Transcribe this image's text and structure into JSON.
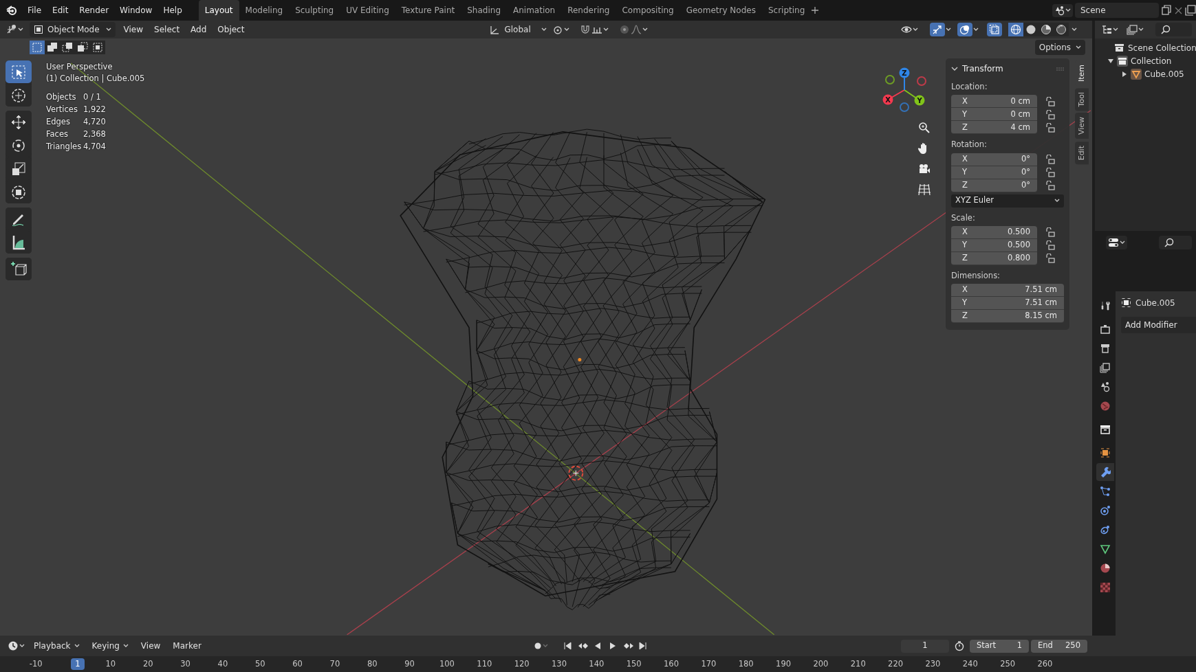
{
  "menu_bar": {
    "menus": [
      "File",
      "Edit",
      "Render",
      "Window",
      "Help"
    ],
    "workspaces": [
      {
        "label": "Layout",
        "selected": true
      },
      {
        "label": "Modeling",
        "selected": false
      },
      {
        "label": "Sculpting",
        "selected": false
      },
      {
        "label": "UV Editing",
        "selected": false
      },
      {
        "label": "Texture Paint",
        "selected": false
      },
      {
        "label": "Shading",
        "selected": false
      },
      {
        "label": "Animation",
        "selected": false
      },
      {
        "label": "Rendering",
        "selected": false
      },
      {
        "label": "Compositing",
        "selected": false
      },
      {
        "label": "Geometry Nodes",
        "selected": false
      },
      {
        "label": "Scripting",
        "selected": false
      }
    ],
    "scene": "Scene"
  },
  "viewport": {
    "toggles": {
      "gizmos": true,
      "overlays": true,
      "xray": true
    },
    "mode": "Object Mode",
    "menus": [
      "View",
      "Select",
      "Add",
      "Object"
    ],
    "orientation": "Global",
    "options": "Options",
    "select_modes": [
      {
        "kind": "new",
        "selected": true
      },
      {
        "kind": "extend",
        "selected": false
      },
      {
        "kind": "subtract",
        "selected": false
      },
      {
        "kind": "difference",
        "selected": false
      },
      {
        "kind": "intersect",
        "selected": false
      }
    ],
    "shading": [
      {
        "kind": "wireframe",
        "selected": true
      },
      {
        "kind": "solid",
        "selected": false
      },
      {
        "kind": "material",
        "selected": false
      },
      {
        "kind": "rendered",
        "selected": false
      }
    ],
    "tool_groups": [
      [
        {
          "kind": "select",
          "selected": true
        },
        {
          "kind": "cursor",
          "selected": false
        }
      ],
      [
        {
          "kind": "move",
          "selected": false
        },
        {
          "kind": "rotate",
          "selected": false
        },
        {
          "kind": "scale",
          "selected": false
        },
        {
          "kind": "transform",
          "selected": false
        }
      ],
      [
        {
          "kind": "annotate",
          "selected": false
        },
        {
          "kind": "measure",
          "selected": false
        }
      ],
      [
        {
          "kind": "add_cube",
          "selected": false
        }
      ]
    ],
    "title": "User Perspective",
    "subtitle": "(1) Collection | Cube.005",
    "stats": [
      {
        "label": "Objects",
        "value": "0 / 1"
      },
      {
        "label": "Vertices",
        "value": "1,922"
      },
      {
        "label": "Edges",
        "value": "4,720"
      },
      {
        "label": "Faces",
        "value": "2,368"
      },
      {
        "label": "Triangles",
        "value": "4,704"
      }
    ],
    "gizmo": [
      {
        "label": "X",
        "color": "#f5394f"
      },
      {
        "label": "Y",
        "color": "#81c41a"
      },
      {
        "label": "Z",
        "color": "#2f86e8"
      }
    ]
  },
  "sidebar": {
    "tabs": [
      {
        "label": "Item",
        "selected": true
      },
      {
        "label": "Tool",
        "selected": false
      },
      {
        "label": "View",
        "selected": false
      },
      {
        "label": "Edit",
        "selected": false
      }
    ],
    "transform": {
      "title": "Transform",
      "groups": [
        {
          "label": "Location:",
          "fields": [
            {
              "axis": "X",
              "value": "0 cm",
              "locked": false
            },
            {
              "axis": "Y",
              "value": "0 cm",
              "locked": false
            },
            {
              "axis": "Z",
              "value": "4 cm",
              "locked": false
            }
          ]
        },
        {
          "label": "Rotation:",
          "fields": [
            {
              "axis": "X",
              "value": "0°",
              "locked": false
            },
            {
              "axis": "Y",
              "value": "0°",
              "locked": false
            },
            {
              "axis": "Z",
              "value": "0°",
              "locked": false
            }
          ],
          "mode": "XYZ Euler"
        },
        {
          "label": "Scale:",
          "fields": [
            {
              "axis": "X",
              "value": "0.500",
              "locked": false
            },
            {
              "axis": "Y",
              "value": "0.500",
              "locked": false
            },
            {
              "axis": "Z",
              "value": "0.800",
              "locked": false
            }
          ]
        },
        {
          "label": "Dimensions:",
          "fields": [
            {
              "axis": "X",
              "value": "7.51 cm"
            },
            {
              "axis": "Y",
              "value": "7.51 cm"
            },
            {
              "axis": "Z",
              "value": "8.15 cm"
            }
          ]
        }
      ]
    }
  },
  "outliner": {
    "tree": [
      {
        "label": "Scene Collection",
        "kind": "scene_collection",
        "children": [
          {
            "label": "Collection",
            "kind": "collection",
            "expanded": true,
            "children": [
              {
                "label": "Cube.005",
                "kind": "mesh_object",
                "expanded": false
              }
            ]
          }
        ]
      }
    ]
  },
  "properties": {
    "tab_groups": [
      [
        {
          "kind": "tool",
          "selected": false
        }
      ],
      [
        {
          "kind": "render",
          "selected": false
        },
        {
          "kind": "output",
          "selected": false
        },
        {
          "kind": "view_layer",
          "selected": false
        },
        {
          "kind": "scene",
          "selected": false
        },
        {
          "kind": "world",
          "selected": false
        }
      ],
      [
        {
          "kind": "collection",
          "selected": false
        }
      ],
      [
        {
          "kind": "object",
          "selected": false
        },
        {
          "kind": "modifiers",
          "selected": true
        },
        {
          "kind": "particles",
          "selected": false
        },
        {
          "kind": "physics",
          "selected": false
        },
        {
          "kind": "constraints",
          "selected": false
        },
        {
          "kind": "data",
          "selected": false
        },
        {
          "kind": "material",
          "selected": false
        },
        {
          "kind": "texture",
          "selected": false
        }
      ]
    ],
    "object": "Cube.005",
    "add_button": "Add Modifier"
  },
  "timeline": {
    "menus": [
      "Playback",
      "Keying",
      "View",
      "Marker"
    ],
    "current_frame": "1",
    "start_label": "Start",
    "start": "1",
    "end_label": "End",
    "end": "250",
    "ticks": [
      {
        "label": "-10"
      },
      {
        "label": "1",
        "kind": "current"
      },
      {
        "label": "10"
      },
      {
        "label": "20"
      },
      {
        "label": "30"
      },
      {
        "label": "40"
      },
      {
        "label": "50"
      },
      {
        "label": "60"
      },
      {
        "label": "70"
      },
      {
        "label": "80"
      },
      {
        "label": "90"
      },
      {
        "label": "100"
      },
      {
        "label": "110"
      },
      {
        "label": "120"
      },
      {
        "label": "130"
      },
      {
        "label": "140"
      },
      {
        "label": "150"
      },
      {
        "label": "160"
      },
      {
        "label": "170"
      },
      {
        "label": "180"
      },
      {
        "label": "190"
      },
      {
        "label": "200"
      },
      {
        "label": "210"
      },
      {
        "label": "220"
      },
      {
        "label": "230"
      },
      {
        "label": "240"
      },
      {
        "label": "250"
      },
      {
        "label": "260"
      }
    ]
  }
}
